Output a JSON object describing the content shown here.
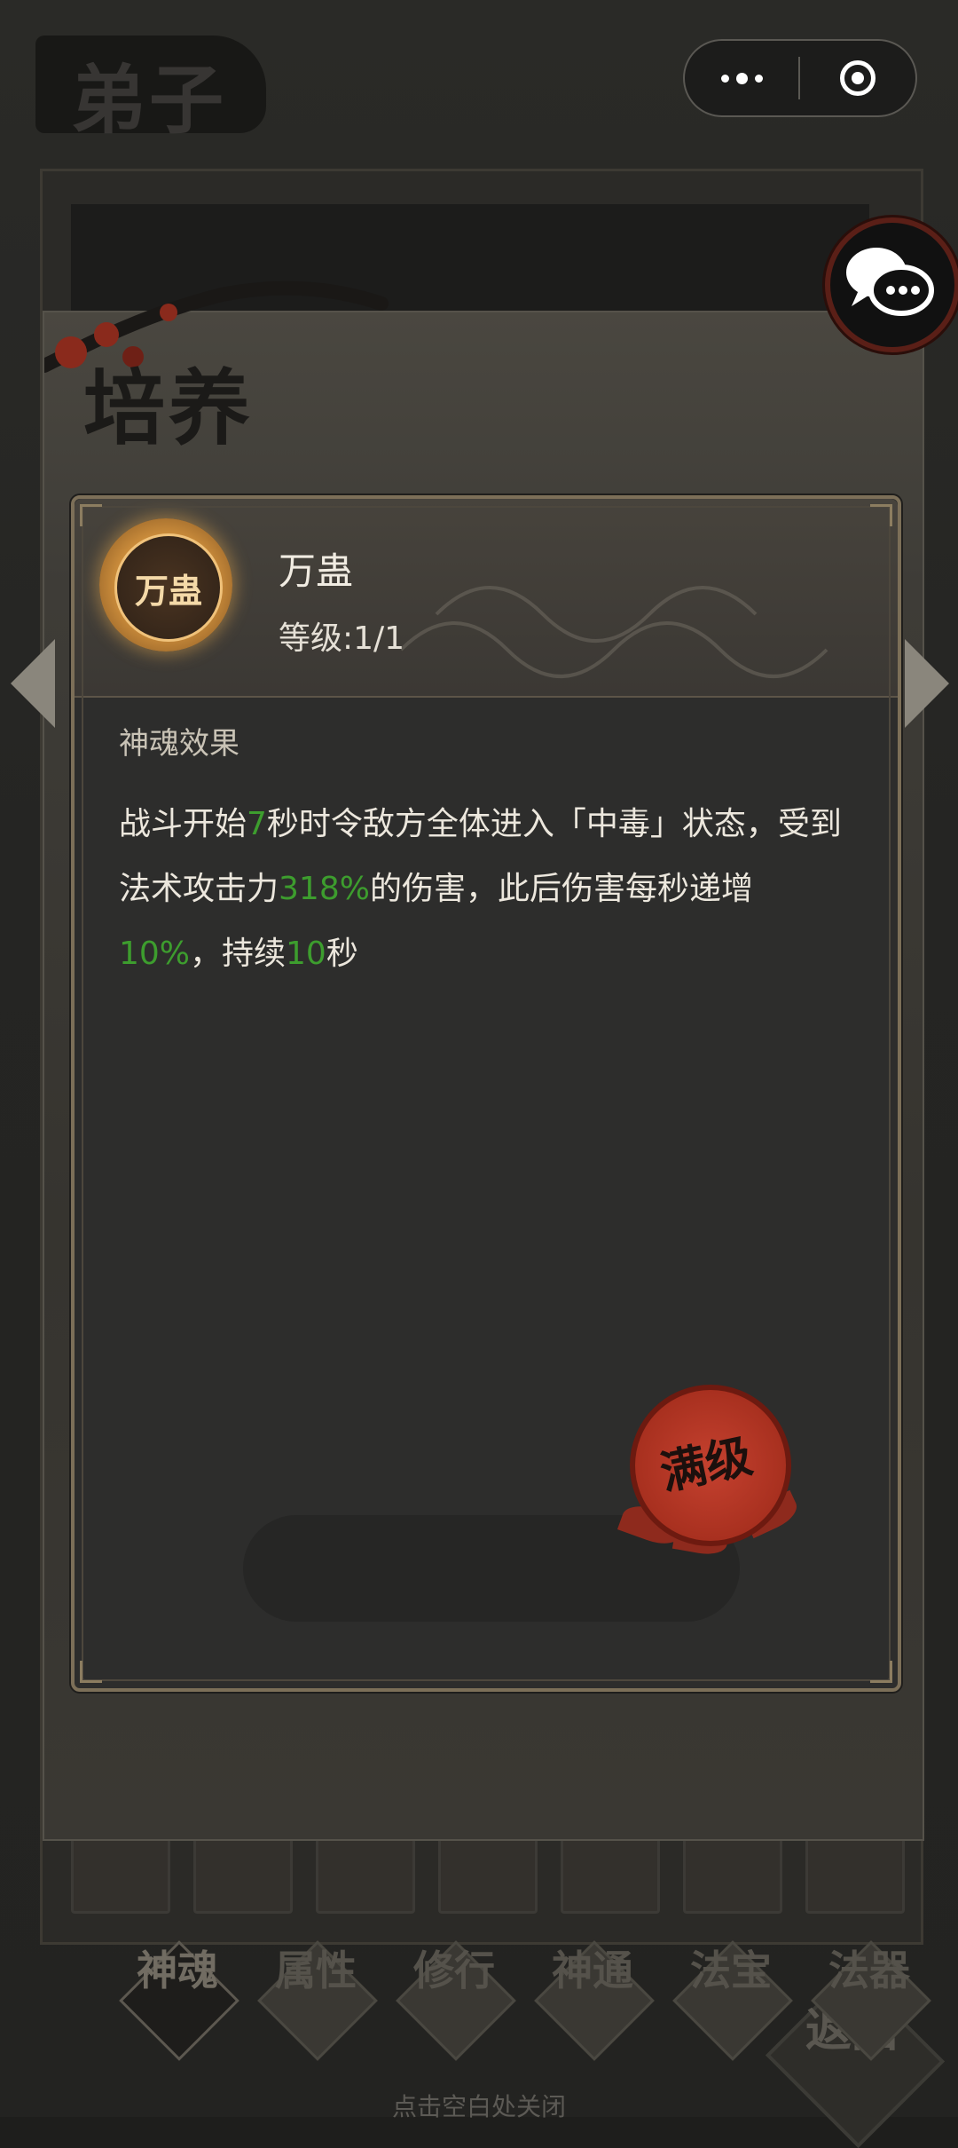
{
  "background": {
    "page_title": "弟子",
    "tabs": [
      "神魂",
      "属性",
      "修行",
      "神通",
      "法宝",
      "法器"
    ],
    "close_hint": "点击空白处关闭",
    "back_label": "返回"
  },
  "capsule": {
    "more_icon": "more-dots-icon",
    "close_icon": "record-close-icon"
  },
  "panel": {
    "title": "培养"
  },
  "skill": {
    "emblem_text": "万蛊",
    "name": "万蛊",
    "level_label": "等级:",
    "level_value": "1/1",
    "section_title": "神魂效果",
    "desc": {
      "p1": "战斗开始",
      "v1": "7",
      "p2": "秒时令敌方全体进入「中毒」状态，受到法术攻击力",
      "v2": "318%",
      "p3": "的伤害，此后伤害每秒递增",
      "v3": "10%",
      "p4": "，持续",
      "v4": "10",
      "p5": "秒"
    },
    "seal_text": "满级"
  },
  "colors": {
    "highlight_green": "#3d9d2e",
    "seal_red": "#b0331f",
    "card_border": "#7c6f58",
    "emblem_gold": "#e9b86a"
  }
}
